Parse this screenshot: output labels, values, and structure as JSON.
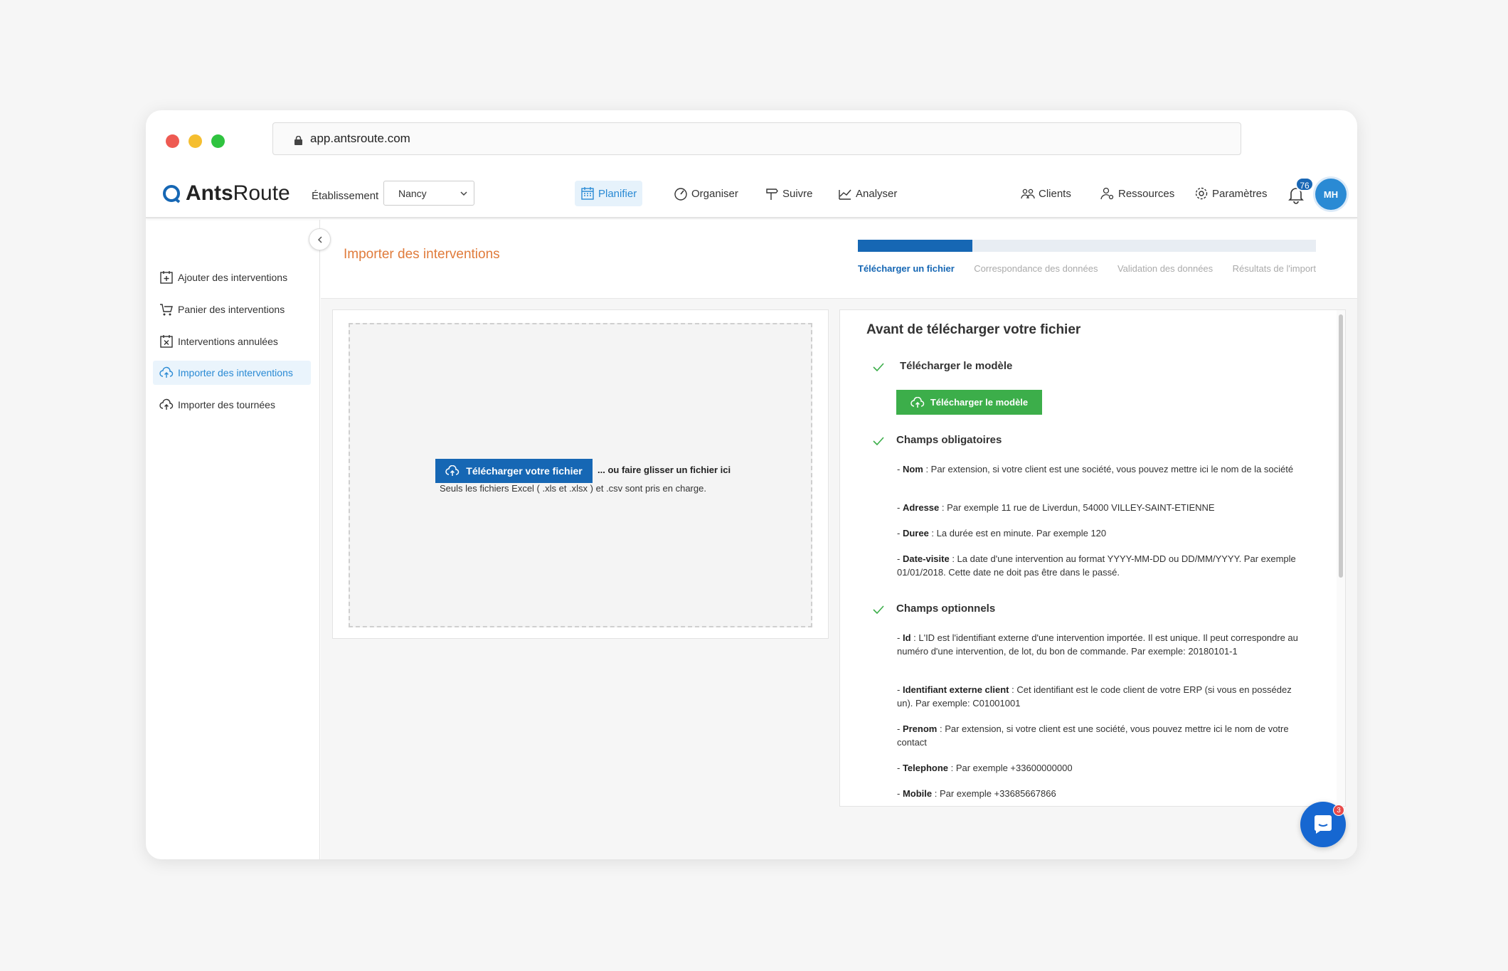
{
  "browser": {
    "url": "app.antsroute.com"
  },
  "navbar": {
    "logo_bold": "Ants",
    "logo_rest": "Route",
    "estab_label": "Établissement",
    "estab_value": "Nancy",
    "items": [
      {
        "label": "Planifier",
        "icon": "calendar-icon"
      },
      {
        "label": "Organiser",
        "icon": "gauge-icon"
      },
      {
        "label": "Suivre",
        "icon": "signpost-icon"
      },
      {
        "label": "Analyser",
        "icon": "chart-icon"
      },
      {
        "label": "Clients",
        "icon": "users-icon"
      },
      {
        "label": "Ressources",
        "icon": "user-gear-icon"
      },
      {
        "label": "Paramètres",
        "icon": "gear-icon"
      }
    ],
    "notif_count": "76",
    "avatar_initials": "MH"
  },
  "sidebar": {
    "items": [
      {
        "label": "Ajouter des interventions",
        "icon": "calendar-plus-icon"
      },
      {
        "label": "Panier des interventions",
        "icon": "cart-icon"
      },
      {
        "label": "Interventions annulées",
        "icon": "calendar-x-icon"
      },
      {
        "label": "Importer des interventions",
        "icon": "cloud-upload-icon"
      },
      {
        "label": "Importer des tournées",
        "icon": "cloud-upload-icon"
      }
    ]
  },
  "page": {
    "title": "Importer des interventions",
    "progress": 0.25,
    "steps": [
      "Télécharger un fichier",
      "Correspondance des données",
      "Validation des données",
      "Résultats de l'import"
    ]
  },
  "dropzone": {
    "button": "Télécharger votre fichier",
    "or_text": "... ou faire glisser un fichier ici",
    "note": "Seuls les fichiers Excel ( .xls et .xlsx ) et .csv sont pris en charge."
  },
  "info": {
    "title": "Avant de télécharger votre fichier",
    "section_model": "Télécharger le modèle",
    "model_button": "Télécharger le modèle",
    "section_required": "Champs obligatoires",
    "required": [
      {
        "name": "Nom",
        "desc": " : Par extension, si votre client est une société, vous pouvez mettre ici le nom de la société"
      },
      {
        "name": "Adresse",
        "desc": " : Par exemple 11 rue de Liverdun, 54000 VILLEY-SAINT-ETIENNE"
      },
      {
        "name": "Duree",
        "desc": " : La durée est en minute. Par exemple 120"
      },
      {
        "name": "Date-visite",
        "desc": " : La date d'une intervention au format YYYY-MM-DD ou DD/MM/YYYY. Par exemple 01/01/2018. Cette date ne doit pas être dans le passé."
      }
    ],
    "section_optional": "Champs optionnels",
    "optional": [
      {
        "name": "Id",
        "desc": " : L'ID est l'identifiant externe d'une intervention importée. Il est unique. Il peut correspondre au numéro d'une intervention, de lot, du bon de commande. Par exemple: 20180101-1"
      },
      {
        "name": "Identifiant externe client",
        "desc": " : Cet identifiant est le code client de votre ERP (si vous en possédez un). Par exemple: C01001001"
      },
      {
        "name": "Prenom",
        "desc": " : Par extension, si votre client est une société, vous pouvez mettre ici le nom de votre contact"
      },
      {
        "name": "Telephone",
        "desc": " : Par exemple +33600000000"
      },
      {
        "name": "Mobile",
        "desc": " : Par exemple +33685667866"
      }
    ]
  },
  "chat": {
    "badge": "3"
  },
  "colors": {
    "primary": "#1667b4",
    "accent_orange": "#e07b3b",
    "green": "#3cae4a"
  }
}
